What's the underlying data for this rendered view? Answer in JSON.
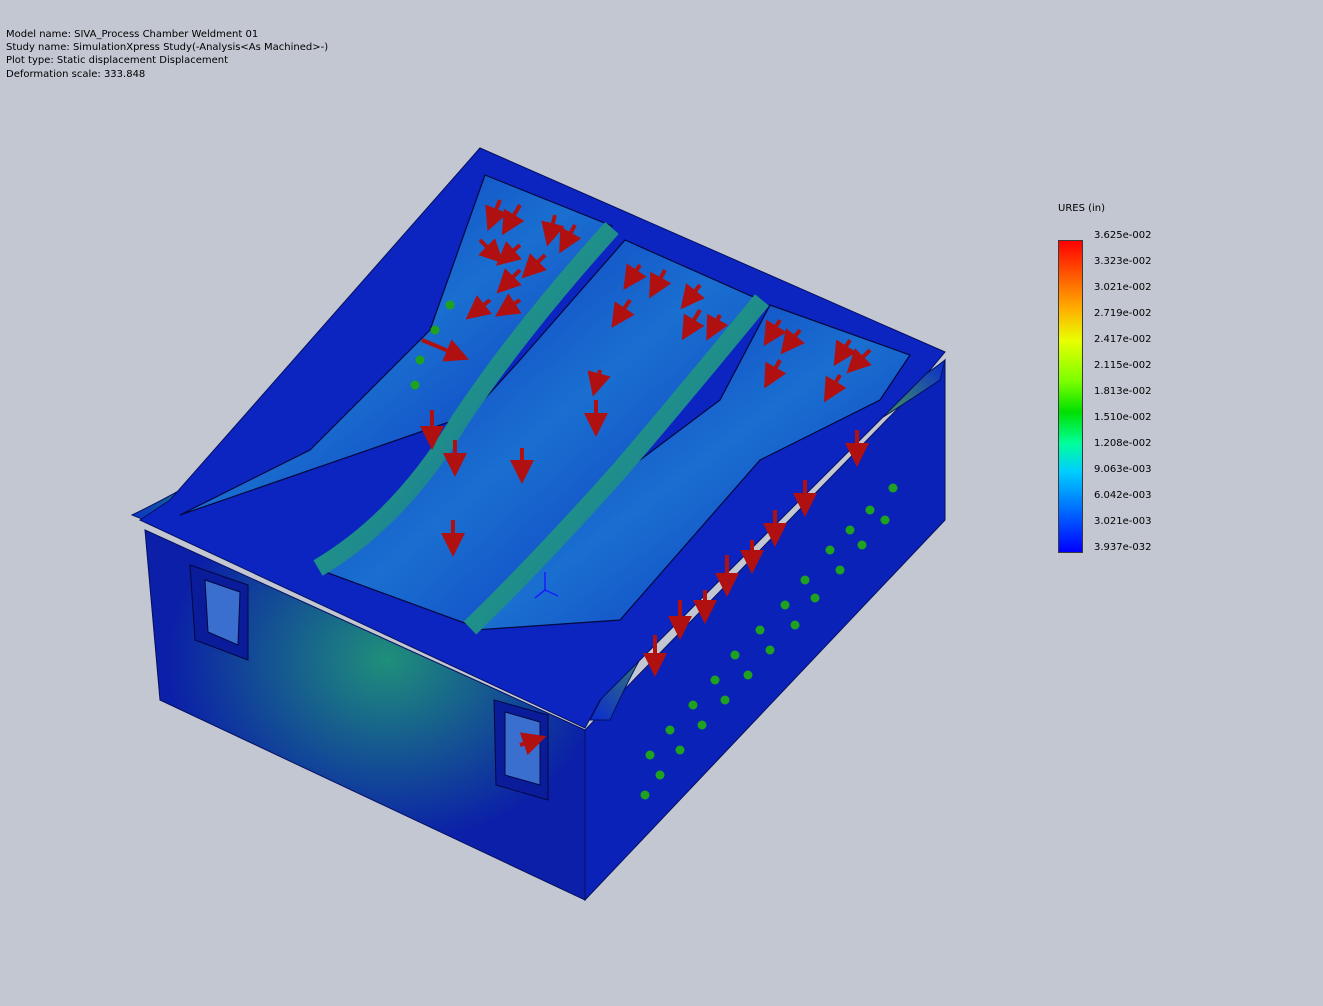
{
  "info": {
    "model_name": "Model name: SIVA_Process Chamber Weldment 01",
    "study_name": "Study name: SimulationXpress Study(-Analysis<As Machined>-)",
    "plot_type": "Plot type: Static displacement Displacement",
    "deformation_scale": "Deformation scale: 333.848"
  },
  "legend": {
    "title": "URES (in)",
    "ticks": [
      "3.625e-002",
      "3.323e-002",
      "3.021e-002",
      "2.719e-002",
      "2.417e-002",
      "2.115e-002",
      "1.813e-002",
      "1.510e-002",
      "1.208e-002",
      "9.063e-003",
      "6.042e-003",
      "3.021e-003",
      "3.937e-032"
    ]
  },
  "colors": {
    "background": "#c3c7d2",
    "model_blue": "#0a1fb0",
    "load_arrow": "#b01010",
    "fixture": "#1fa31f"
  }
}
